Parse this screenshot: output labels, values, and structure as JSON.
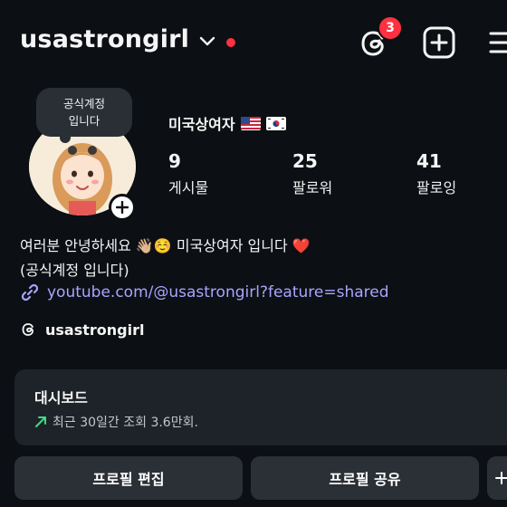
{
  "header": {
    "username": "usastrongirl",
    "notification_count": "3"
  },
  "profile": {
    "note": [
      "공식계정",
      "입니다"
    ],
    "display_name": "미국상여자",
    "stats": [
      {
        "value": "9",
        "label": "게시물"
      },
      {
        "value": "25",
        "label": "팔로워"
      },
      {
        "value": "41",
        "label": "팔로잉"
      }
    ],
    "bio_line1": "여러분 안녕하세요 👋🏼☺️ 미국상여자 입니다 ❤️",
    "bio_line2": "(공식계정 입니다)",
    "link": "youtube.com/@usastrongirl?feature=shared",
    "threads_handle": "usastrongirl"
  },
  "dashboard": {
    "title": "대시보드",
    "subtitle": "최근 30일간 조회 3.6만회."
  },
  "actions": {
    "edit_profile": "프로필 편집",
    "share_profile": "프로필 공유"
  },
  "colors": {
    "background": "#0c0f14",
    "notification": "#ff3040",
    "link": "#a9a4ff",
    "card": "#1e2329",
    "button": "#2b3037",
    "trend": "#3ddc84"
  }
}
